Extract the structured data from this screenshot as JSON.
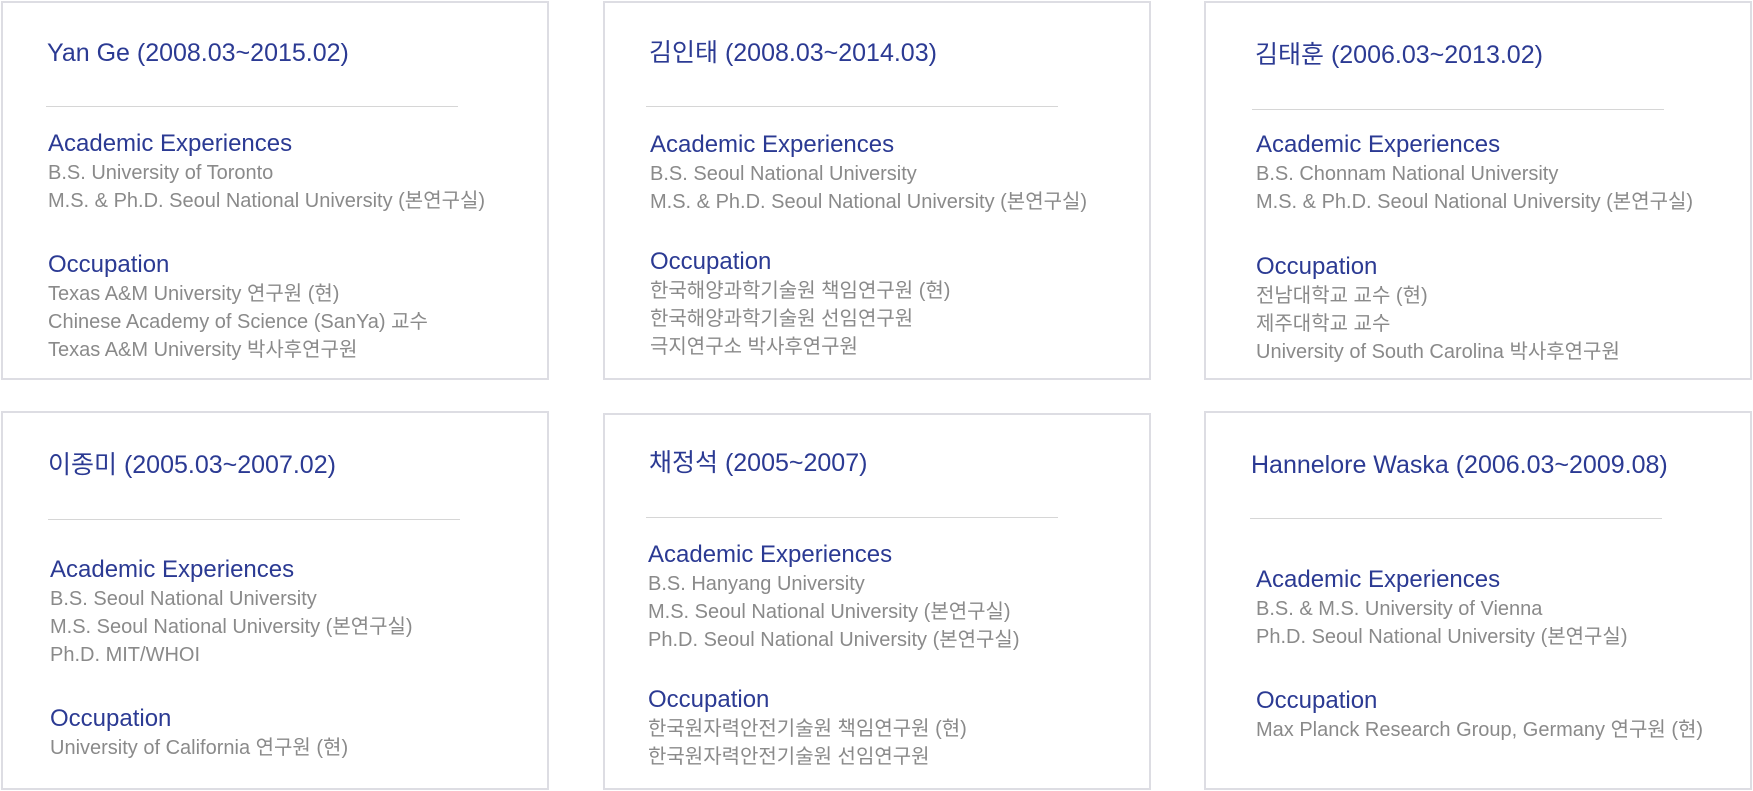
{
  "labels": {
    "academic": "Academic Experiences",
    "occupation": "Occupation"
  },
  "alumni": [
    {
      "name": "Yan Ge (2008.03~2015.02)",
      "academic": [
        "B.S. University of Toronto",
        "M.S. & Ph.D. Seoul National University (본연구실)"
      ],
      "occupation": [
        "Texas A&M University 연구원 (현)",
        "Chinese Academy of Science (SanYa) 교수",
        "Texas A&M University 박사후연구원"
      ]
    },
    {
      "name": "김인태 (2008.03~2014.03)",
      "academic": [
        "B.S. Seoul National University",
        "M.S. & Ph.D. Seoul National University (본연구실)"
      ],
      "occupation": [
        "한국해양과학기술원 책임연구원 (현)",
        "한국해양과학기술원 선임연구원",
        "극지연구소 박사후연구원"
      ]
    },
    {
      "name": "김태훈 (2006.03~2013.02)",
      "academic": [
        "B.S. Chonnam National University",
        "M.S. & Ph.D. Seoul National University (본연구실)"
      ],
      "occupation": [
        "전남대학교 교수 (현)",
        "제주대학교 교수",
        "University of South Carolina 박사후연구원"
      ]
    },
    {
      "name": "이종미 (2005.03~2007.02)",
      "academic": [
        "B.S. Seoul National University",
        "M.S. Seoul National University (본연구실)",
        "Ph.D. MIT/WHOI"
      ],
      "occupation": [
        "University of California 연구원 (현)"
      ]
    },
    {
      "name": "채정석 (2005~2007)",
      "academic": [
        "B.S. Hanyang University",
        "M.S. Seoul National University (본연구실)",
        "Ph.D. Seoul National University  (본연구실)"
      ],
      "occupation": [
        "한국원자력안전기술원 책임연구원 (현)",
        "한국원자력안전기술원 선임연구원"
      ]
    },
    {
      "name": "Hannelore Waska (2006.03~2009.08)",
      "academic": [
        "B.S. & M.S. University of Vienna",
        "Ph.D. Seoul National University (본연구실)"
      ],
      "occupation": [
        "Max Planck Research Group, Germany 연구원 (현)"
      ]
    }
  ]
}
